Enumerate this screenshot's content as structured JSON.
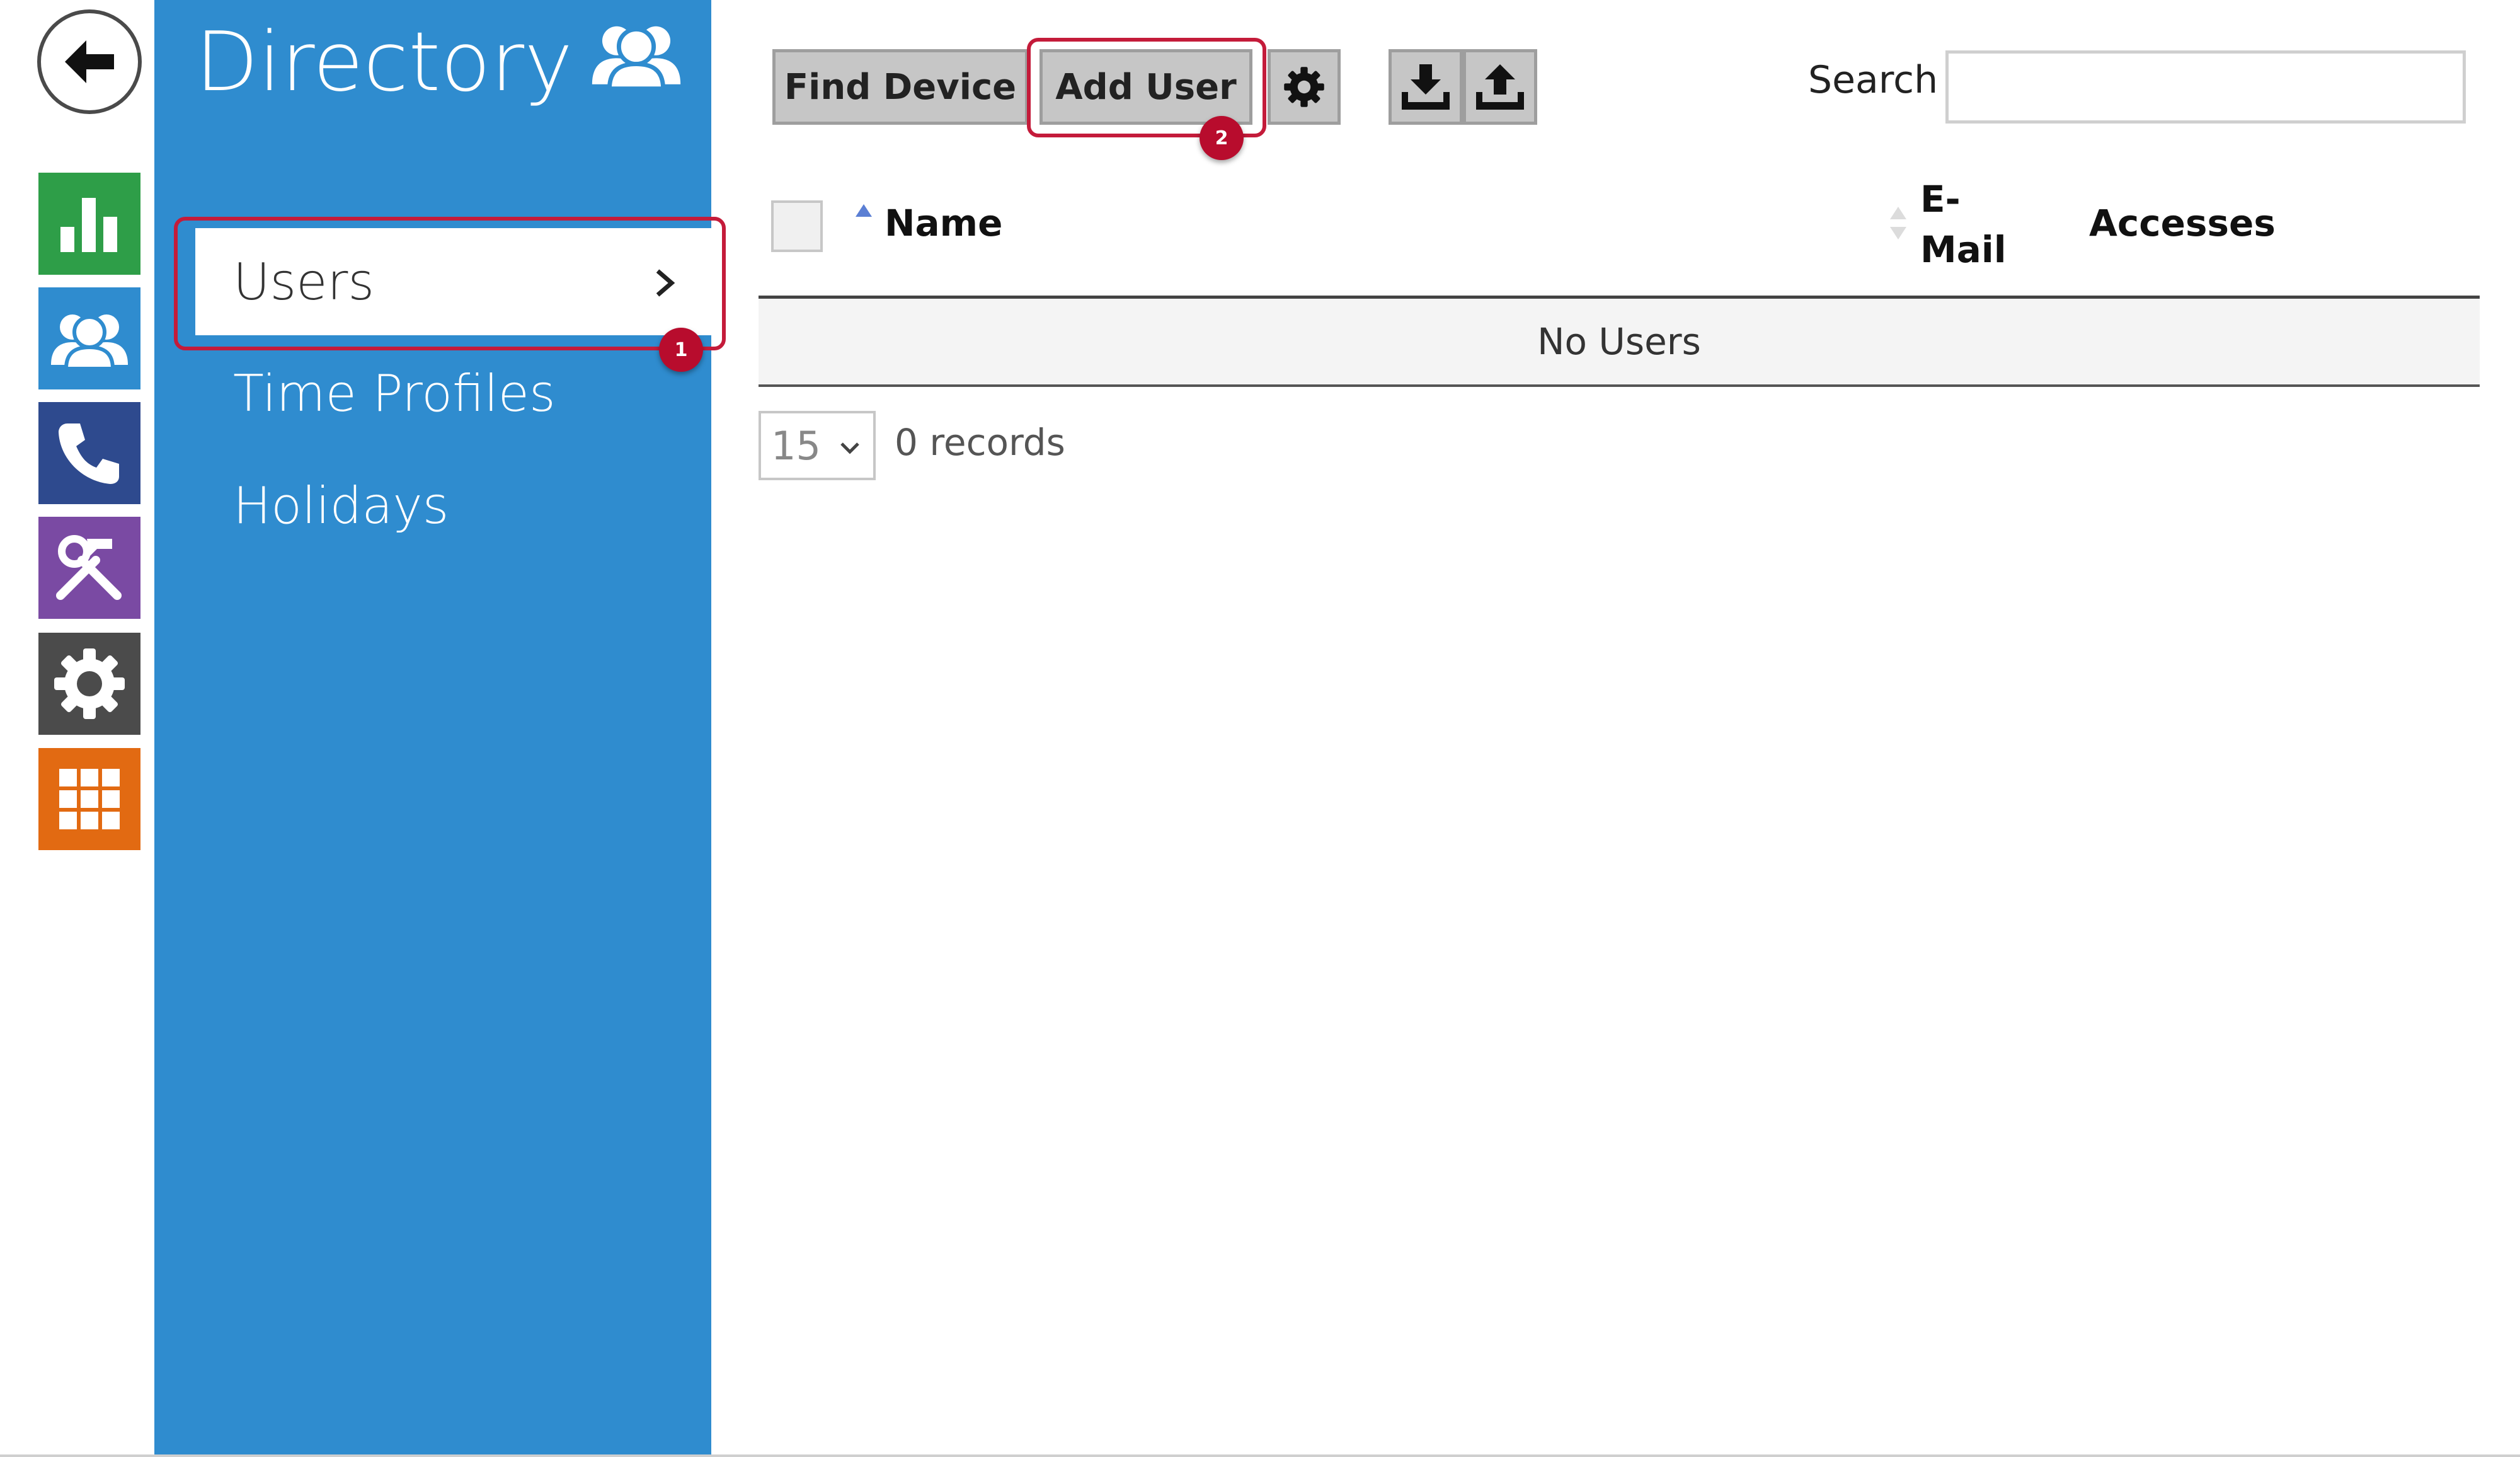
{
  "nav": {
    "back_icon": "back-arrow-icon",
    "rail": [
      {
        "name": "status",
        "icon": "bar-chart-icon",
        "color": "#2e9e48"
      },
      {
        "name": "directory",
        "icon": "users-icon",
        "color": "#2f8ccf"
      },
      {
        "name": "calls",
        "icon": "phone-icon",
        "color": "#2e4a8e"
      },
      {
        "name": "hardware",
        "icon": "tools-icon",
        "color": "#7a4aa3"
      },
      {
        "name": "system",
        "icon": "gear-icon",
        "color": "#4b4b4b"
      },
      {
        "name": "services",
        "icon": "grid-icon",
        "color": "#e26a12"
      }
    ]
  },
  "sidebar": {
    "title": "Directory",
    "title_icon": "users-icon",
    "color": "#2f8ccf",
    "items": [
      {
        "label": "Users",
        "active": true
      },
      {
        "label": "Time Profiles",
        "active": false
      },
      {
        "label": "Holidays",
        "active": false
      }
    ]
  },
  "callouts": {
    "first": "1",
    "second": "2",
    "color": "#c41b3a"
  },
  "toolbar": {
    "find_device_label": "Find Device",
    "add_user_label": "Add User",
    "settings_icon": "gear-icon",
    "download_icon": "download-icon",
    "upload_icon": "upload-icon",
    "search_label": "Search",
    "search_value": ""
  },
  "table": {
    "columns": [
      "Name",
      "E-\nMail",
      "Accesses"
    ],
    "col_name": "Name",
    "col_email_line1": "E-",
    "col_email_line2": "Mail",
    "col_accesses": "Accesses",
    "empty_message": "No Users"
  },
  "pagination": {
    "page_size": "15",
    "records_text": "0 records"
  }
}
